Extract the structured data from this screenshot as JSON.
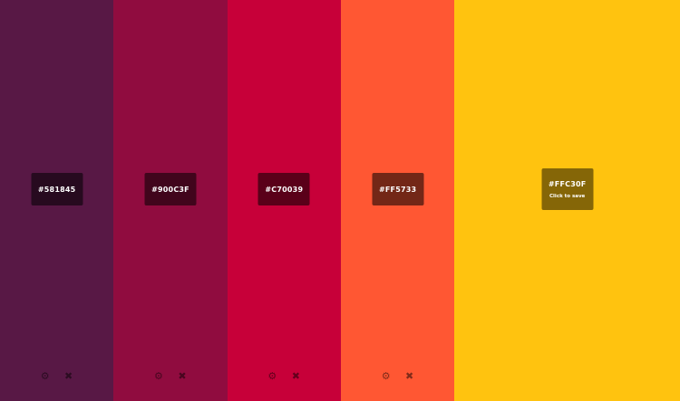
{
  "colors": [
    {
      "hex": "#581845",
      "value": "#581845"
    },
    {
      "hex": "#900C3F",
      "value": "#900C3F"
    },
    {
      "hex": "#C70039",
      "value": "#C70039"
    },
    {
      "hex": "#FF5733",
      "value": "#FF5733"
    },
    {
      "hex": "#FFC30F",
      "value": "#FFC30F",
      "hint": "Click to save"
    }
  ],
  "icons": {
    "settings": "gear-icon",
    "remove": "close-icon"
  }
}
